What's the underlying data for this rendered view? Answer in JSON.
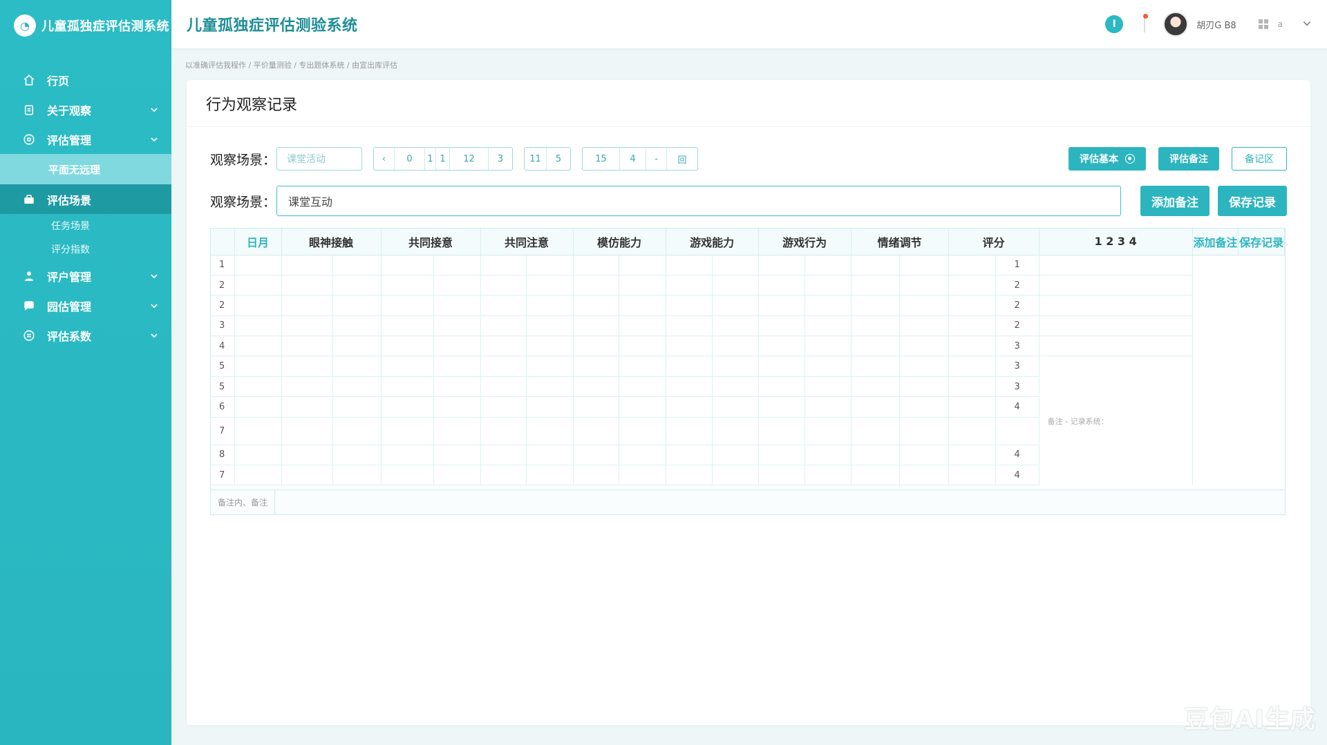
{
  "app": {
    "logo_text": "儿童孤独症评估测系统",
    "header_title": "儿童孤独症评估测验系统"
  },
  "header": {
    "username": "胡刃G B8",
    "small_label": "a"
  },
  "sidebar": {
    "items": [
      {
        "label": "行页",
        "icon": "home-icon",
        "has_chevron": false
      },
      {
        "label": "关于观察",
        "icon": "clipboard-icon",
        "has_chevron": true
      },
      {
        "label": "评估管理",
        "icon": "target-icon",
        "has_chevron": true
      }
    ],
    "sub_active": "平面无远理",
    "active_item": {
      "label": "评估场景",
      "icon": "briefcase-icon"
    },
    "sub_items": [
      "任务场景",
      "评分指数"
    ],
    "items_after": [
      {
        "label": "评户管理",
        "icon": "user-group-icon",
        "has_chevron": true
      },
      {
        "label": "园估管理",
        "icon": "chat-icon",
        "has_chevron": true
      },
      {
        "label": "评估系数",
        "icon": "settings-circle-icon",
        "has_chevron": true
      }
    ]
  },
  "breadcrumb": "以准确评估我程作 / 平价量测验 / 专出题体系统 / 由宣出库评估",
  "card": {
    "title": "行为观察记录",
    "row1": {
      "label": "观察场景：",
      "select_placeholder": "课堂活动",
      "pager_a": [
        "‹",
        "0",
        "1",
        "1",
        "12",
        "3"
      ],
      "pager_b": [
        "11",
        "5"
      ],
      "pager_c": [
        "15",
        "4",
        "-",
        "回"
      ],
      "btn_assess": "评估基本",
      "btn_notes": "评估备注",
      "btn_record": "备记区"
    },
    "row2": {
      "label": "观察场景：",
      "input_value": "课堂互动",
      "btn_add": "添加备注",
      "btn_save": "保存记录"
    },
    "table": {
      "headers": [
        "日月",
        "眼神接触",
        "共同接意",
        "共同注意",
        "模仿能力",
        "游戏能力",
        "游戏行为",
        "情绪调节",
        "评分",
        "1 2  3  4",
        "添加备注",
        "保存记录"
      ],
      "rows": [
        {
          "idx": "1",
          "score": "1"
        },
        {
          "idx": "2",
          "score": "2"
        },
        {
          "idx": "2",
          "score": "2"
        },
        {
          "idx": "3",
          "score": "2"
        },
        {
          "idx": "4",
          "score": "3"
        },
        {
          "idx": "5",
          "score": "3"
        },
        {
          "idx": "5",
          "score": "3"
        },
        {
          "idx": "6",
          "score": "4"
        },
        {
          "idx": "7",
          "score": ""
        },
        {
          "idx": "8",
          "score": "4"
        },
        {
          "idx": "7",
          "score": "4"
        }
      ],
      "side_note": "备注 - 记录系统：",
      "footer": "备注内、备注"
    }
  },
  "watermark": "豆包AI生成"
}
